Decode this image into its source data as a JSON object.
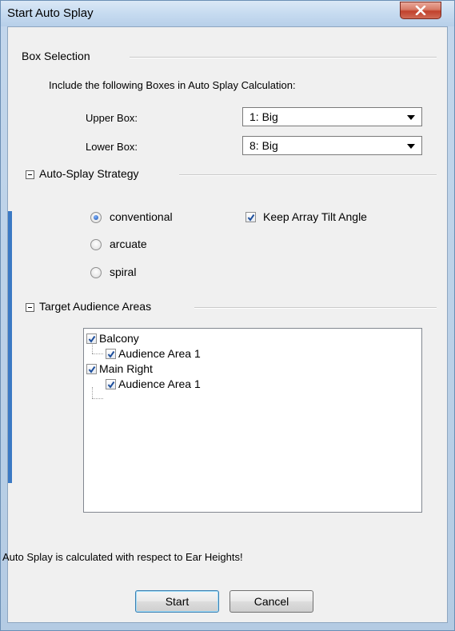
{
  "window": {
    "title": "Start Auto Splay",
    "close_glyph": "X"
  },
  "box_selection": {
    "title": "Box Selection",
    "instruction": "Include the following Boxes in Auto Splay Calculation:",
    "upper_label": "Upper Box:",
    "upper_value": "1: Big",
    "lower_label": "Lower Box:",
    "lower_value": "8: Big"
  },
  "strategy": {
    "title": "Auto-Splay Strategy",
    "options": [
      {
        "label": "conventional",
        "checked": true
      },
      {
        "label": "arcuate",
        "checked": false
      },
      {
        "label": "spiral",
        "checked": false
      }
    ],
    "keep_tilt_label": "Keep Array Tilt Angle",
    "keep_tilt_checked": true
  },
  "audience": {
    "title": "Target Audience Areas",
    "tree": [
      {
        "label": "Balcony",
        "checked": true,
        "children": [
          {
            "label": "Audience Area 1",
            "checked": true
          }
        ]
      },
      {
        "label": "Main Right",
        "checked": true,
        "children": [
          {
            "label": "Audience Area 1",
            "checked": true
          }
        ]
      }
    ]
  },
  "footer": {
    "note": "Auto Splay is calculated with respect to Ear Heights!",
    "start_label": "Start",
    "cancel_label": "Cancel"
  },
  "colors": {
    "accent": "#3b79c4",
    "check": "#1e4f9c",
    "close_red": "#c1412c"
  }
}
